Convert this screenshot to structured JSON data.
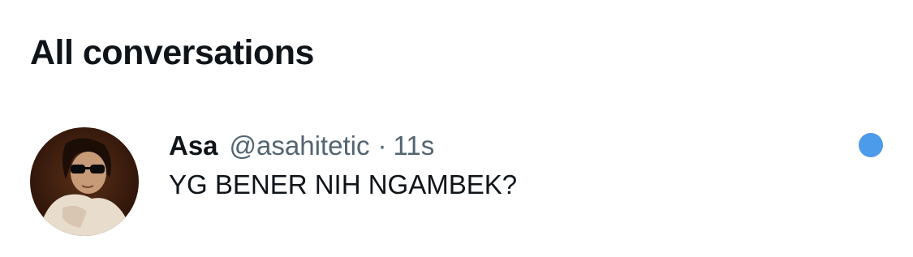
{
  "header": {
    "title": "All conversations"
  },
  "conversation": {
    "display_name": "Asa",
    "handle": "@asahitetic",
    "separator": "·",
    "timestamp": "11s",
    "message": "YG BENER NIH NGAMBEK?",
    "avatar_icon": "user-avatar-photo",
    "unread": true,
    "unread_color": "#4c9bea"
  }
}
